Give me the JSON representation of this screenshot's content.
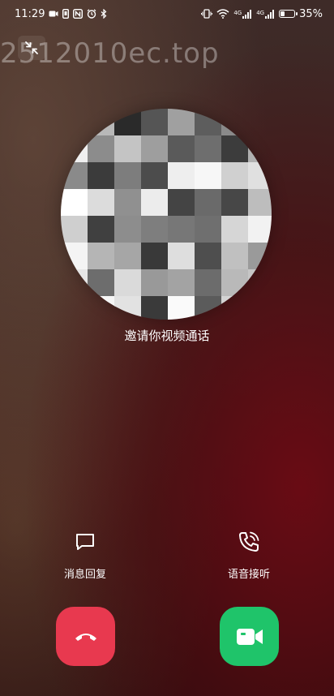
{
  "status_bar": {
    "time": "11:29",
    "battery_percent": "35%",
    "battery_level": 0.35,
    "network_1": "4G",
    "network_2": "4G"
  },
  "watermark": "2512010ec.top",
  "caller": {
    "name": "",
    "subtitle": "邀请你视频通话"
  },
  "actions": {
    "message_reply": "消息回复",
    "voice_answer": "语音接听"
  },
  "colors": {
    "decline": "#e8394f",
    "accept": "#1fc46a"
  },
  "icons": {
    "minimize": "minimize-icon",
    "message": "message-icon",
    "phone": "phone-icon",
    "decline": "hangup-icon",
    "accept": "video-camera-icon"
  }
}
